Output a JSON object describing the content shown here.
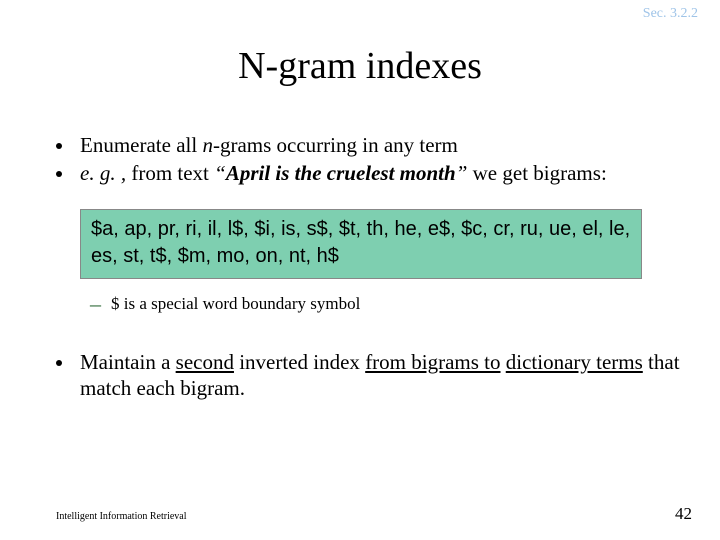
{
  "section_label": "Sec. 3.2.2",
  "title": "N-gram indexes",
  "bullets": {
    "b1": {
      "pre": "Enumerate all ",
      "ngrams": "n",
      "post": "-grams occurring in any term"
    },
    "b2": {
      "eg": "e. g. , ",
      "from_text": "from text ",
      "quote_open": "“",
      "phrase": "April is the cruelest month",
      "quote_close": "” ",
      "tail": "we get bigrams:"
    }
  },
  "bigrams": "$a, ap, pr, ri, il, l$, $i, is, s$, $t, th, he, e$, $c, cr, ru, ue, el, le, es, st, t$, $m, mo, on, nt, h$",
  "sub": "$ is a special word boundary symbol",
  "b3": {
    "t1": "Maintain a ",
    "second": "second",
    "t2": " inverted index ",
    "from_bigrams": "from bigrams to",
    "t3": " ",
    "dict_terms": "dictionary terms",
    "t4": " that match each bigram."
  },
  "footer": {
    "left": "Intelligent Information Retrieval",
    "right": "42"
  }
}
